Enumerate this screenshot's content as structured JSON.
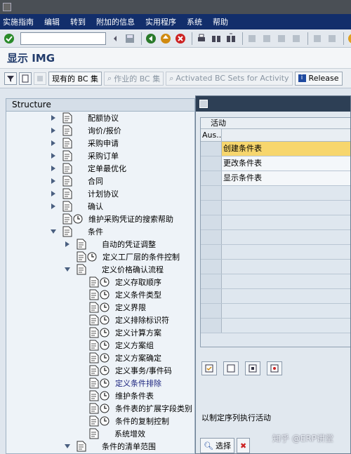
{
  "window": {
    "title_glyph": "☐"
  },
  "menubar": [
    "实施指南",
    "编辑",
    "转到",
    "附加的信息",
    "实用程序",
    "系统",
    "帮助"
  ],
  "toolbar": {
    "icons": [
      "check-icon",
      "back-icon",
      "save-icon",
      "nav-back-icon",
      "exit-icon",
      "cancel-icon",
      "print-icon",
      "find-icon",
      "find-next-icon",
      "first-page-icon",
      "prev-page-icon",
      "next-page-icon",
      "last-page-icon",
      "new-session-icon",
      "shortcut-icon",
      "help-icon"
    ]
  },
  "app": {
    "title": "显示 IMG",
    "buttons": {
      "existing_bc": "现有的 BC 集",
      "bc_for_activity": "作业的 BC 集",
      "activated_bc": "Activated BC Sets for Activity",
      "release": "Release"
    }
  },
  "tree": {
    "header": "Structure",
    "nodes": [
      {
        "label": "配额协议",
        "arrow": "right",
        "clock": false
      },
      {
        "label": "询价/报价",
        "arrow": "right",
        "clock": false
      },
      {
        "label": "采购申请",
        "arrow": "right",
        "clock": false
      },
      {
        "label": "采购订单",
        "arrow": "right",
        "clock": false
      },
      {
        "label": "定单最优化",
        "arrow": "right",
        "clock": false
      },
      {
        "label": "合同",
        "arrow": "right",
        "clock": false
      },
      {
        "label": "计划协议",
        "arrow": "right",
        "clock": false
      },
      {
        "label": "确认",
        "arrow": "right",
        "clock": false
      },
      {
        "label": "维护采购凭证的搜索帮助",
        "arrow": "none",
        "clock": true
      },
      {
        "label": "条件",
        "arrow": "down",
        "clock": false
      },
      {
        "label": "自动的凭证调整",
        "arrow": "right",
        "clock": false
      },
      {
        "label": "定义工厂层的条件控制",
        "arrow": "none",
        "clock": true
      },
      {
        "label": "定义价格确认流程",
        "arrow": "down",
        "clock": false
      },
      {
        "label": "定义存取顺序",
        "arrow": "none",
        "clock": true
      },
      {
        "label": "定义条件类型",
        "arrow": "none",
        "clock": true
      },
      {
        "label": "定义界限",
        "arrow": "none",
        "clock": true
      },
      {
        "label": "定义排除标识符",
        "arrow": "none",
        "clock": true
      },
      {
        "label": "定义计算方案",
        "arrow": "none",
        "clock": true
      },
      {
        "label": "定义方案组",
        "arrow": "none",
        "clock": true
      },
      {
        "label": "定义方案确定",
        "arrow": "none",
        "clock": true
      },
      {
        "label": "定义事务/事件码",
        "arrow": "none",
        "clock": true
      },
      {
        "label": "定义条件排除",
        "arrow": "none",
        "clock": true
      },
      {
        "label": "维护条件表",
        "arrow": "none",
        "clock": true
      },
      {
        "label": "条件表的扩展字段类别",
        "arrow": "none",
        "clock": true
      },
      {
        "label": "条件的复制控制",
        "arrow": "none",
        "clock": true
      },
      {
        "label": "系统增效",
        "arrow": "none",
        "clock": false
      },
      {
        "label": "条件的清单范围",
        "arrow": "down",
        "clock": false
      }
    ]
  },
  "dialog": {
    "grid_header": "活动",
    "col_header": "Aus...",
    "rows": [
      "创建条件表",
      "更改条件表",
      "显示条件表",
      "",
      "",
      "",
      "",
      "",
      "",
      "",
      "",
      "",
      ""
    ],
    "footer_text": "以制定序列执行活动",
    "select_label": "选择"
  },
  "watermark": "知乎 @ERP讲堂",
  "colors": {
    "menubar": "#122e6b",
    "highlight": "#f7d66d",
    "tree_bg": "#eef3f8"
  }
}
